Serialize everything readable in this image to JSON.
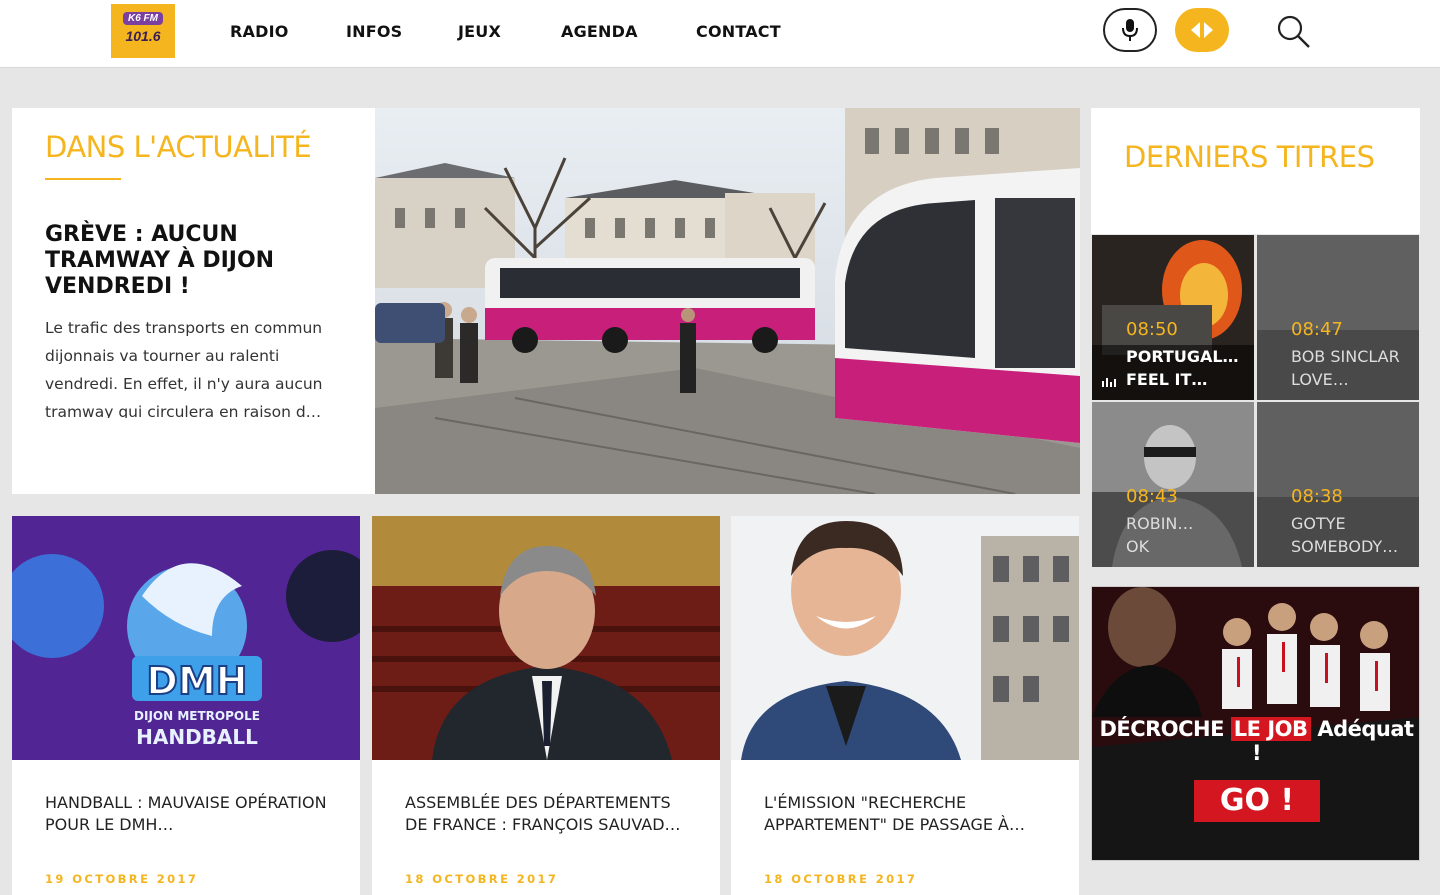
{
  "brand": {
    "freq_small": "K6 FM",
    "freq_big": "101.6"
  },
  "nav": {
    "items": [
      "RADIO",
      "INFOS",
      "JEUX",
      "AGENDA",
      "CONTACT"
    ]
  },
  "header_icons": {
    "mic": "microphone-icon",
    "play": "play-pause-icon",
    "search": "search-icon"
  },
  "featured": {
    "section_title": "DANS L'ACTUALITÉ",
    "headline": "GRÈVE : AUCUN TRAMWAY À DIJON VENDREDI !",
    "summary": "Le trafic des transports en commun dijonnais va tourner au ralenti vendredi. En effet, il n'y aura aucun tramway qui circulera en raison d…"
  },
  "articles": [
    {
      "title": "HANDBALL : MAUVAISE OPÉRATION POUR LE DMH…",
      "date": "19 OCTOBRE 2017",
      "img_text_1": "DMH",
      "img_text_2": "DIJON METROPOLE",
      "img_text_3": "HANDBALL"
    },
    {
      "title": "ASSEMBLÉE DES DÉPARTEMENTS DE FRANCE : FRANÇOIS SAUVAD…",
      "date": "18 OCTOBRE 2017"
    },
    {
      "title": "L'ÉMISSION \"RECHERCHE APPARTEMENT\" DE PASSAGE À…",
      "date": "18 OCTOBRE 2017"
    }
  ],
  "sidebar": {
    "section_title": "DERNIERS TITRES",
    "tracks": [
      {
        "time": "08:50",
        "line1": "PORTUGAL…",
        "line2": "FEEL IT…"
      },
      {
        "time": "08:47",
        "line1": "BOB SINCLAR",
        "line2": "LOVE…"
      },
      {
        "time": "08:43",
        "line1": "ROBIN…",
        "line2": "OK"
      },
      {
        "time": "08:38",
        "line1": "GOTYE",
        "line2": "SOMEBODY…"
      }
    ]
  },
  "ad": {
    "text_a": "DÉCROCHE",
    "text_b": "LE JOB",
    "text_c": "Adéquat !",
    "cta": "GO !"
  },
  "colors": {
    "accent": "#f5b51f",
    "ad_red": "#d41620",
    "tram_pink": "#c81f7a"
  }
}
